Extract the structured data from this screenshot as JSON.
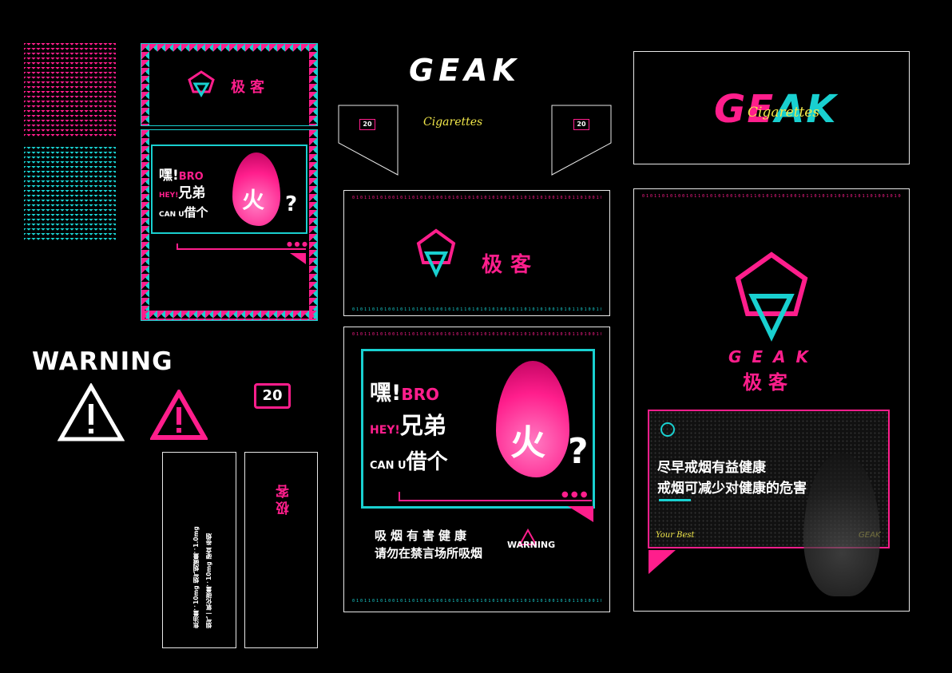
{
  "brand": {
    "name_en": "GEAK",
    "name_cn": "极客",
    "cigarettes": "Cigarettes",
    "geak_spaced": "G E A K",
    "badge_20": "20",
    "your_best": "Your Best"
  },
  "slogans": {
    "hey": "嘿!",
    "bro": "BRO",
    "hey_en": "HEY!",
    "xiongdi": "兄弟",
    "can_u": "CAN U",
    "borrow": "借个",
    "fire_char": "火",
    "question": "?",
    "mini_1": "兄弟",
    "mini_2": "borrow"
  },
  "health": {
    "line1": "吸烟有害健康",
    "line2": "请勿在禁言场所吸烟",
    "warning": "WARNING",
    "quit1": "尽早戒烟有益健康",
    "quit2": "戒烟可减少对健康的危害"
  },
  "side_text": {
    "tar": "焦油量：10mg  烟气烟碱量：1.0mg",
    "co": "烟气一氧化碳量：10mg  硬盒 卷烟",
    "brand_vertical": "极客"
  },
  "warning_title": "WARNING",
  "binary": "0101101010010110101010010101101010101001011010101001010110100101011010",
  "colors": {
    "pink": "#ff1e8c",
    "cyan": "#19d0d0",
    "black": "#000000",
    "white": "#ffffff"
  }
}
